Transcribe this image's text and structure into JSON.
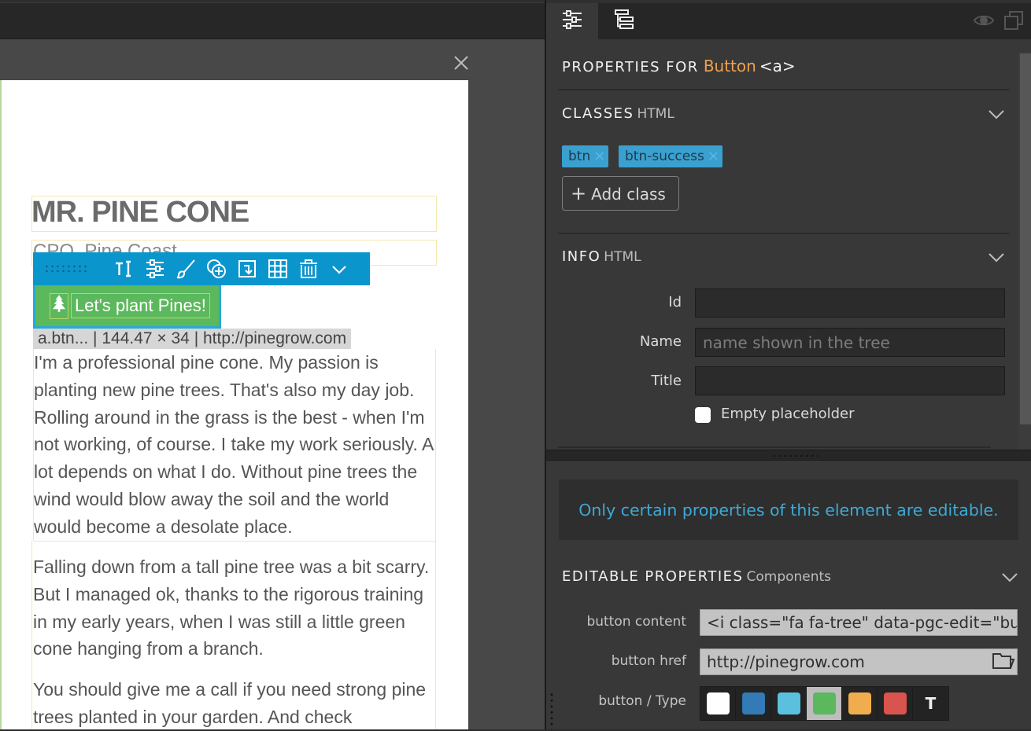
{
  "canvas": {
    "close_label": "close",
    "page": {
      "heading": "MR. PINE CONE",
      "subtitle": "CPO, Pine Coast",
      "button": {
        "icon": "tree-icon",
        "label": "Let's plant Pines!",
        "color": "#5cb85c"
      },
      "selection_info": "a.btn... | 144.47 × 34 | http://pinegrow.com",
      "paragraphs": [
        "I'm a professional pine cone. My passion is planting new pine trees. That's also my day job. Rolling around in the grass is the best - when I'm not working, of course. I take my work seriously. A lot depends on what I do. Without pine trees the wind would blow away the soil and the world would become a desolate place.",
        "Falling down from a tall pine tree was a bit scarry. But I managed ok, thanks to the rigorous training in my early years, when I was still a little green cone hanging from a branch.",
        "You should give me a call if you need strong pine trees planted in your garden. And check"
      ]
    },
    "element_toolbar": {
      "color": "#0a95cd",
      "icons": [
        "edit-text-icon",
        "properties-icon",
        "style-brush-icon",
        "insert-element-icon",
        "move-into-icon",
        "grid-icon",
        "delete-icon",
        "more-chevron-icon"
      ]
    }
  },
  "panel": {
    "tabs": [
      {
        "icon": "sliders-icon",
        "active": true
      },
      {
        "icon": "tree-view-icon",
        "active": false
      }
    ],
    "header": {
      "prefix": "PROPERTIES FOR",
      "element_name": "Button",
      "element_tag": "<a>",
      "accent_color": "#f0a050"
    },
    "classes": {
      "title": "CLASSES",
      "sub": "HTML",
      "chips": [
        "btn",
        "btn-success"
      ],
      "add_label": "Add class"
    },
    "info": {
      "title": "INFO",
      "sub": "HTML",
      "fields": [
        {
          "label": "Id",
          "value": "",
          "placeholder": ""
        },
        {
          "label": "Name",
          "value": "",
          "placeholder": "name shown in the tree"
        },
        {
          "label": "Title",
          "value": "",
          "placeholder": ""
        }
      ],
      "empty_placeholder": {
        "label": "Empty placeholder",
        "checked": false
      }
    },
    "notice": "Only certain properties of this element are editable.",
    "editable": {
      "title": "EDITABLE PROPERTIES",
      "sub": "Components",
      "fields": [
        {
          "label": "button content",
          "value": "<i class=\"fa fa-tree\" data-pgc-edit=\"butt"
        },
        {
          "label": "button href",
          "value": "http://pinegrow.com"
        }
      ],
      "type": {
        "label": "button / Type",
        "options": [
          {
            "name": "default",
            "color": "#ffffff"
          },
          {
            "name": "primary",
            "color": "#337ab7"
          },
          {
            "name": "info",
            "color": "#5bc0de"
          },
          {
            "name": "success",
            "color": "#5cb85c",
            "selected": true
          },
          {
            "name": "warning",
            "color": "#f0ad4e"
          },
          {
            "name": "danger",
            "color": "#d9534f"
          },
          {
            "name": "text",
            "glyph": "T"
          }
        ]
      }
    }
  }
}
